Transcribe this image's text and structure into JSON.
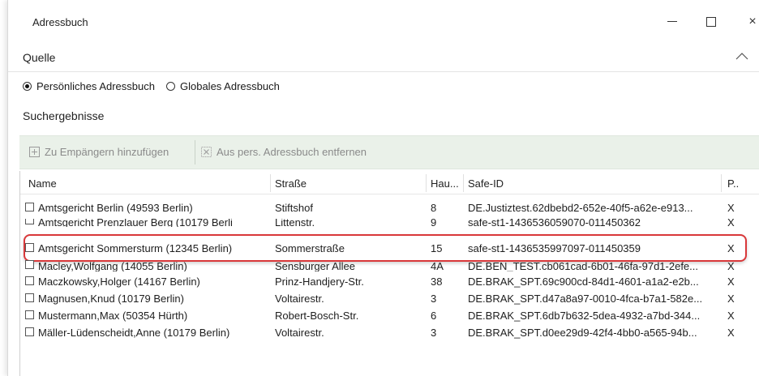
{
  "window": {
    "title": "Adressbuch",
    "controls": {
      "minimize": "minimize-icon",
      "maximize": "maximize-icon",
      "close": "×"
    }
  },
  "source": {
    "heading": "Quelle",
    "options": [
      {
        "label": "Persönliches Adressbuch",
        "checked": true
      },
      {
        "label": "Globales Adressbuch",
        "checked": false
      }
    ]
  },
  "results": {
    "heading": "Suchergebnisse",
    "toolbar": {
      "add_label": "Zu Empängern hinzufügen",
      "remove_label": "Aus pers. Adressbuch entfernen"
    },
    "columns": [
      "Name",
      "Straße",
      "Hau...",
      "Safe-ID",
      "P.."
    ],
    "rows": [
      {
        "name": "Amtsgericht Berlin (49593 Berlin)",
        "street": "Stiftshof",
        "hnr": "8",
        "safe_id": "DE.Justiztest.62dbebd2-652e-40f5-a62e-e913...",
        "p": "X"
      },
      {
        "name": "Amtsgericht Prenzlauer Berg (10179 Berli",
        "street": "Littenstr.",
        "hnr": "9",
        "safe_id": "safe-st1-1436536059070-011450362",
        "p": "X"
      },
      {
        "name": "Amtsgericht Sommersturm (12345 Berlin)",
        "street": "Sommerstraße",
        "hnr": "15",
        "safe_id": "safe-st1-1436535997097-011450359",
        "p": "X"
      },
      {
        "name": "Macley,Wolfgang (14055 Berlin)",
        "street": "Sensburger Allee",
        "hnr": "4A",
        "safe_id": "DE.BEN_TEST.cb061cad-6b01-46fa-97d1-2efe...",
        "p": "X"
      },
      {
        "name": "Maczkowsky,Holger (14167 Berlin)",
        "street": "Prinz-Handjery-Str.",
        "hnr": "38",
        "safe_id": "DE.BRAK_SPT.69c900cd-84d1-4601-a1a2-e2b...",
        "p": "X"
      },
      {
        "name": "Magnusen,Knud (10179 Berlin)",
        "street": "Voltairestr.",
        "hnr": "3",
        "safe_id": "DE.BRAK_SPT.d47a8a97-0010-4fca-b7a1-582e...",
        "p": "X"
      },
      {
        "name": "Mustermann,Max (50354 Hürth)",
        "street": "Robert-Bosch-Str.",
        "hnr": "6",
        "safe_id": "DE.BRAK_SPT.6db7b632-5dea-4932-a7bd-344...",
        "p": "X"
      },
      {
        "name": "Mäller-Lüdenscheidt,Anne (10179 Berlin)",
        "street": "Voltairestr.",
        "hnr": "3",
        "safe_id": "DE.BRAK_SPT.d0ee29d9-42f4-4bb0-a565-94b...",
        "p": "X"
      }
    ]
  },
  "colors": {
    "highlight": "#d9383a",
    "toolbar_bg": "#eaf1e9"
  }
}
